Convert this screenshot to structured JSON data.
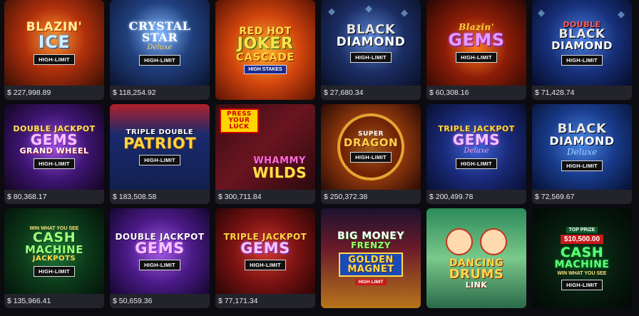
{
  "games": [
    {
      "title_lines": [
        "BLAZIN'",
        "ICE"
      ],
      "badge": "HIGH-LIMIT",
      "jackpot": "$ 227,998.89"
    },
    {
      "title_lines": [
        "CRYSTAL STAR"
      ],
      "subtitle": "Deluxe",
      "badge": "HIGH-LIMIT",
      "jackpot": "$ 118,254.92"
    },
    {
      "title_lines": [
        "RED HOT",
        "JOKER",
        "CASCADE"
      ],
      "badge": "HIGH STAKES",
      "jackpot": ""
    },
    {
      "title_lines": [
        "BLACK",
        "DIAMOND"
      ],
      "badge": "HIGH-LIMIT",
      "jackpot": "$ 27,680.34"
    },
    {
      "title_lines": [
        "Blazin'",
        "GEMS"
      ],
      "badge": "HIGH-LIMIT",
      "jackpot": "$ 60,308.16"
    },
    {
      "title_lines": [
        "DOUBLE",
        "BLACK",
        "DIAMOND"
      ],
      "badge": "HIGH-LIMIT",
      "jackpot": "$ 71,428.74"
    },
    {
      "title_lines": [
        "DOUBLE JACKPOT",
        "GEMS",
        "GRAND WHEEL"
      ],
      "badge": "HIGH-LIMIT",
      "jackpot": "$ 80,368.17"
    },
    {
      "title_lines": [
        "TRIPLE DOUBLE",
        "PATRIOT"
      ],
      "badge": "HIGH-LIMIT",
      "jackpot": "$ 183,508.58"
    },
    {
      "title_lines": [
        "PRESS",
        "YOUR",
        "LUCK",
        "WHAMMY",
        "WILDS"
      ],
      "badge": "",
      "jackpot": "$ 300,711.84"
    },
    {
      "title_lines": [
        "SUPER",
        "DRAGON"
      ],
      "badge": "HIGH-LIMIT",
      "jackpot": "$ 250,372.38"
    },
    {
      "title_lines": [
        "TRIPLE JACKPOT",
        "GEMS"
      ],
      "subtitle": "Deluxe",
      "badge": "HIGH-LIMIT",
      "jackpot": "$ 200,499.78"
    },
    {
      "title_lines": [
        "BLACK",
        "DIAMOND"
      ],
      "subtitle": "Deluxe",
      "badge": "HIGH-LIMIT",
      "jackpot": "$ 72,569.67"
    },
    {
      "title_lines": [
        "WIN WHAT YOU SEE",
        "CASH",
        "MACHINE",
        "JACKPOTS"
      ],
      "badge": "HIGH-LIMIT",
      "jackpot": "$ 135,966.41"
    },
    {
      "title_lines": [
        "DOUBLE JACKPOT",
        "GEMS"
      ],
      "badge": "HIGH-LIMIT",
      "jackpot": "$ 50,659.36"
    },
    {
      "title_lines": [
        "TRIPLE JACKPOT",
        "GEMS"
      ],
      "badge": "HIGH-LIMIT",
      "jackpot": "$ 77,171.34"
    },
    {
      "title_lines": [
        "BIG MONEY",
        "FRENZY",
        "GOLDEN",
        "MAGNET"
      ],
      "badge": "HIGH LIMIT",
      "jackpot": ""
    },
    {
      "title_lines": [
        "DANCING",
        "DRUMS",
        "LINK"
      ],
      "badge": "",
      "jackpot": ""
    },
    {
      "title_lines": [
        "TOP PRIZE",
        "$10,500.00",
        "CASH",
        "MACHINE",
        "WIN WHAT YOU SEE"
      ],
      "badge": "HIGH-LIMIT",
      "jackpot": ""
    }
  ],
  "colors": {
    "page_bg": "#0b0b10",
    "jackpot_bar": "#23232b",
    "jackpot_text": "#e9e9ee"
  }
}
